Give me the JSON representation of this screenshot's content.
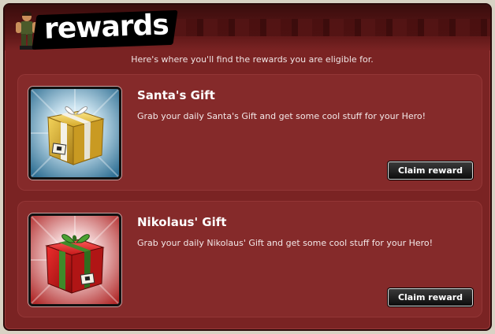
{
  "header": {
    "title": "rewards",
    "subtitle": "Here's where you'll find the rewards you are eligible for."
  },
  "rewards": [
    {
      "title": "Santa's Gift",
      "description": "Grab your daily Santa's Gift and get some cool stuff for your Hero!",
      "button_label": "Claim reward",
      "icon": "gold-gift-box-icon"
    },
    {
      "title": "Nikolaus' Gift",
      "description": "Grab your daily Nikolaus' Gift and get some cool stuff for your Hero!",
      "button_label": "Claim reward",
      "icon": "red-gift-box-icon"
    }
  ],
  "colors": {
    "panel_bg": "#7a2323",
    "card_bg": "#852a2a",
    "button_bg": "#111111"
  }
}
